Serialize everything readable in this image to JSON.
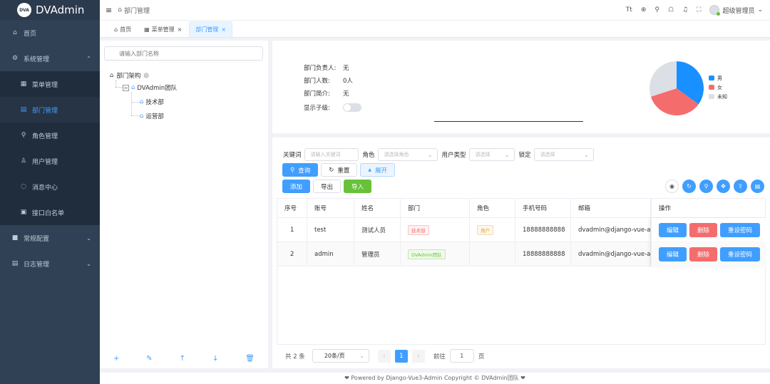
{
  "app": {
    "logo_badge": "DVA",
    "title": "DVAdmin"
  },
  "sidebar": {
    "items": [
      {
        "icon": "home-icon",
        "glyph": "⌂",
        "label": "首页"
      },
      {
        "icon": "gear-icon",
        "glyph": "⚙",
        "label": "系统管理",
        "arrow": "⌃"
      },
      {
        "icon": "grid-icon",
        "glyph": "▦",
        "label": "菜单管理"
      },
      {
        "icon": "dept-icon",
        "glyph": "▤",
        "label": "部门管理"
      },
      {
        "icon": "role-icon",
        "glyph": "⚲",
        "label": "角色管理"
      },
      {
        "icon": "user-icon",
        "glyph": "♙",
        "label": "用户管理"
      },
      {
        "icon": "message-icon",
        "glyph": "◌",
        "label": "消息中心"
      },
      {
        "icon": "whitelist-icon",
        "glyph": "▣",
        "label": "接口白名单"
      },
      {
        "icon": "config-icon",
        "glyph": "■",
        "label": "常规配置",
        "arrow": "⌄"
      },
      {
        "icon": "log-icon",
        "glyph": "▤",
        "label": "日志管理",
        "arrow": "⌄"
      }
    ]
  },
  "topbar": {
    "breadcrumb": "部门管理",
    "user": "超级管理员",
    "icons": {
      "font": "Tt",
      "globe": "⊕",
      "search": "⚲",
      "shirt": "☖",
      "bell": "♫",
      "fullscreen": "⛶",
      "caret": "⌄"
    }
  },
  "tabs": [
    {
      "icon": "⌂",
      "label": "首页"
    },
    {
      "icon": "▦",
      "label": "菜单管理",
      "close": "×"
    },
    {
      "icon": "",
      "label": "部门管理",
      "close": "×"
    }
  ],
  "tree": {
    "placeholder": "请输入部门名称",
    "root": "部门架构",
    "team": "DVAdmin团队",
    "children": [
      "技术部",
      "运营部"
    ],
    "actions": {
      "add": "+",
      "edit": "✎",
      "up": "↑",
      "down": "↓",
      "delete": "🗑"
    }
  },
  "info": {
    "leader_label": "部门负责人:",
    "leader_value": "无",
    "count_label": "部门人数:",
    "count_value": "0人",
    "intro_label": "部门简介:",
    "intro_value": "无",
    "show_children_label": "显示子级:"
  },
  "chart_data": {
    "type": "pie",
    "categories": [
      "男",
      "女",
      "未知"
    ],
    "values": [
      35,
      35,
      30
    ],
    "colors": [
      "#1890ff",
      "#f56c6c",
      "#dcdfe6"
    ]
  },
  "filters": {
    "keyword_label": "关键词",
    "keyword_placeholder": "请输入关键词",
    "role_label": "角色",
    "role_placeholder": "请选择角色",
    "usertype_label": "用户类型",
    "usertype_placeholder": "请选择",
    "lock_label": "锁定",
    "lock_placeholder": "请选择"
  },
  "buttons": {
    "query": "查询",
    "reset": "重置",
    "expand": "展开",
    "add": "添加",
    "export": "导出",
    "import": "导入"
  },
  "table": {
    "headers": [
      "序号",
      "账号",
      "姓名",
      "部门",
      "角色",
      "手机号码",
      "邮箱",
      "操作"
    ],
    "rows": [
      {
        "no": "1",
        "account": "test",
        "name": "测试人员",
        "dept": "技术部",
        "dept_color": "red",
        "role": "用户",
        "phone": "18888888888",
        "email": "dvadmin@django-vue-admin.com"
      },
      {
        "no": "2",
        "account": "admin",
        "name": "管理员",
        "dept": "DVAdmin团队",
        "dept_color": "green",
        "role": "",
        "phone": "18888888888",
        "email": "dvadmin@django-vue-admin.com"
      }
    ],
    "op": {
      "edit": "编辑",
      "delete": "删除",
      "reset_pwd": "重设密码"
    }
  },
  "pager": {
    "total": "共 2 条",
    "page_size": "20条/页",
    "prev": "‹",
    "current": "1",
    "next": "›",
    "goto_label": "前往",
    "goto_value": "1",
    "page_suffix": "页"
  },
  "footer": "❤ Powered by Django-Vue3-Admin Copyright © DVAdmin团队 ❤"
}
